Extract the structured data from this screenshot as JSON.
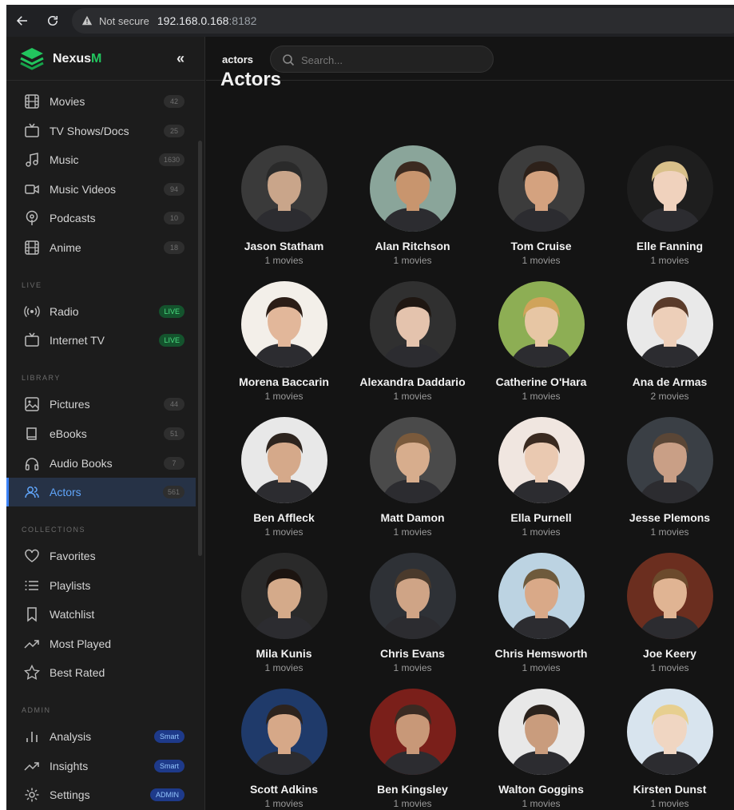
{
  "browser": {
    "not_secure": "Not secure",
    "url_host": "192.168.0.168",
    "url_port": ":8182"
  },
  "brand": {
    "name_prefix": "Nexus",
    "name_suffix": "M",
    "collapse": "«"
  },
  "sidebar": {
    "media": [
      {
        "label": "Movies",
        "count": "42",
        "icon": "film-icon"
      },
      {
        "label": "TV Shows/Docs",
        "count": "25",
        "icon": "tv-icon"
      },
      {
        "label": "Music",
        "count": "1630",
        "icon": "music-note-icon"
      },
      {
        "label": "Music Videos",
        "count": "94",
        "icon": "video-camera-icon"
      },
      {
        "label": "Podcasts",
        "count": "10",
        "icon": "podcast-icon"
      },
      {
        "label": "Anime",
        "count": "18",
        "icon": "film-icon"
      }
    ],
    "live_head": "LIVE",
    "live": [
      {
        "label": "Radio",
        "badge": "LIVE",
        "icon": "radio-icon"
      },
      {
        "label": "Internet TV",
        "badge": "LIVE",
        "icon": "tv-icon"
      }
    ],
    "library_head": "LIBRARY",
    "library": [
      {
        "label": "Pictures",
        "count": "44",
        "icon": "image-icon"
      },
      {
        "label": "eBooks",
        "count": "51",
        "icon": "book-icon"
      },
      {
        "label": "Audio Books",
        "count": "7",
        "icon": "headphones-icon"
      },
      {
        "label": "Actors",
        "count": "561",
        "icon": "users-icon"
      }
    ],
    "collections_head": "COLLECTIONS",
    "collections": [
      {
        "label": "Favorites",
        "icon": "heart-icon"
      },
      {
        "label": "Playlists",
        "icon": "list-icon"
      },
      {
        "label": "Watchlist",
        "icon": "bookmark-icon"
      },
      {
        "label": "Most Played",
        "icon": "trending-icon"
      },
      {
        "label": "Best Rated",
        "icon": "star-icon"
      }
    ],
    "admin_head": "ADMIN",
    "admin": [
      {
        "label": "Analysis",
        "badge": "Smart",
        "icon": "bar-chart-icon"
      },
      {
        "label": "Insights",
        "badge": "Smart",
        "icon": "trending-icon"
      },
      {
        "label": "Settings",
        "badge": "ADMIN",
        "icon": "gear-icon"
      }
    ]
  },
  "topbar": {
    "crumb": "actors",
    "search_placeholder": "Search..."
  },
  "main": {
    "title": "Actors",
    "actors": [
      {
        "name": "Jason Statham",
        "count": "1 movies"
      },
      {
        "name": "Alan Ritchson",
        "count": "1 movies"
      },
      {
        "name": "Tom Cruise",
        "count": "1 movies"
      },
      {
        "name": "Elle Fanning",
        "count": "1 movies"
      },
      {
        "name": "Morena Baccarin",
        "count": "1 movies"
      },
      {
        "name": "Alexandra Daddario",
        "count": "1 movies"
      },
      {
        "name": "Catherine O'Hara",
        "count": "1 movies"
      },
      {
        "name": "Ana de Armas",
        "count": "2 movies"
      },
      {
        "name": "Ben Affleck",
        "count": "1 movies"
      },
      {
        "name": "Matt Damon",
        "count": "1 movies"
      },
      {
        "name": "Ella Purnell",
        "count": "1 movies"
      },
      {
        "name": "Jesse Plemons",
        "count": "1 movies"
      },
      {
        "name": "Mila Kunis",
        "count": "1 movies"
      },
      {
        "name": "Chris Evans",
        "count": "1 movies"
      },
      {
        "name": "Chris Hemsworth",
        "count": "1 movies"
      },
      {
        "name": "Joe Keery",
        "count": "1 movies"
      },
      {
        "name": "Scott Adkins",
        "count": "1 movies"
      },
      {
        "name": "Ben Kingsley",
        "count": "1 movies"
      },
      {
        "name": "Walton Goggins",
        "count": "1 movies"
      },
      {
        "name": "Kirsten Dunst",
        "count": "1 movies"
      }
    ]
  },
  "colors": {
    "accent": "#3b82f6",
    "brand_green": "#22c55e",
    "live_green": "#4ade80",
    "background": "#141414",
    "sidebar": "#1c1c1c"
  }
}
